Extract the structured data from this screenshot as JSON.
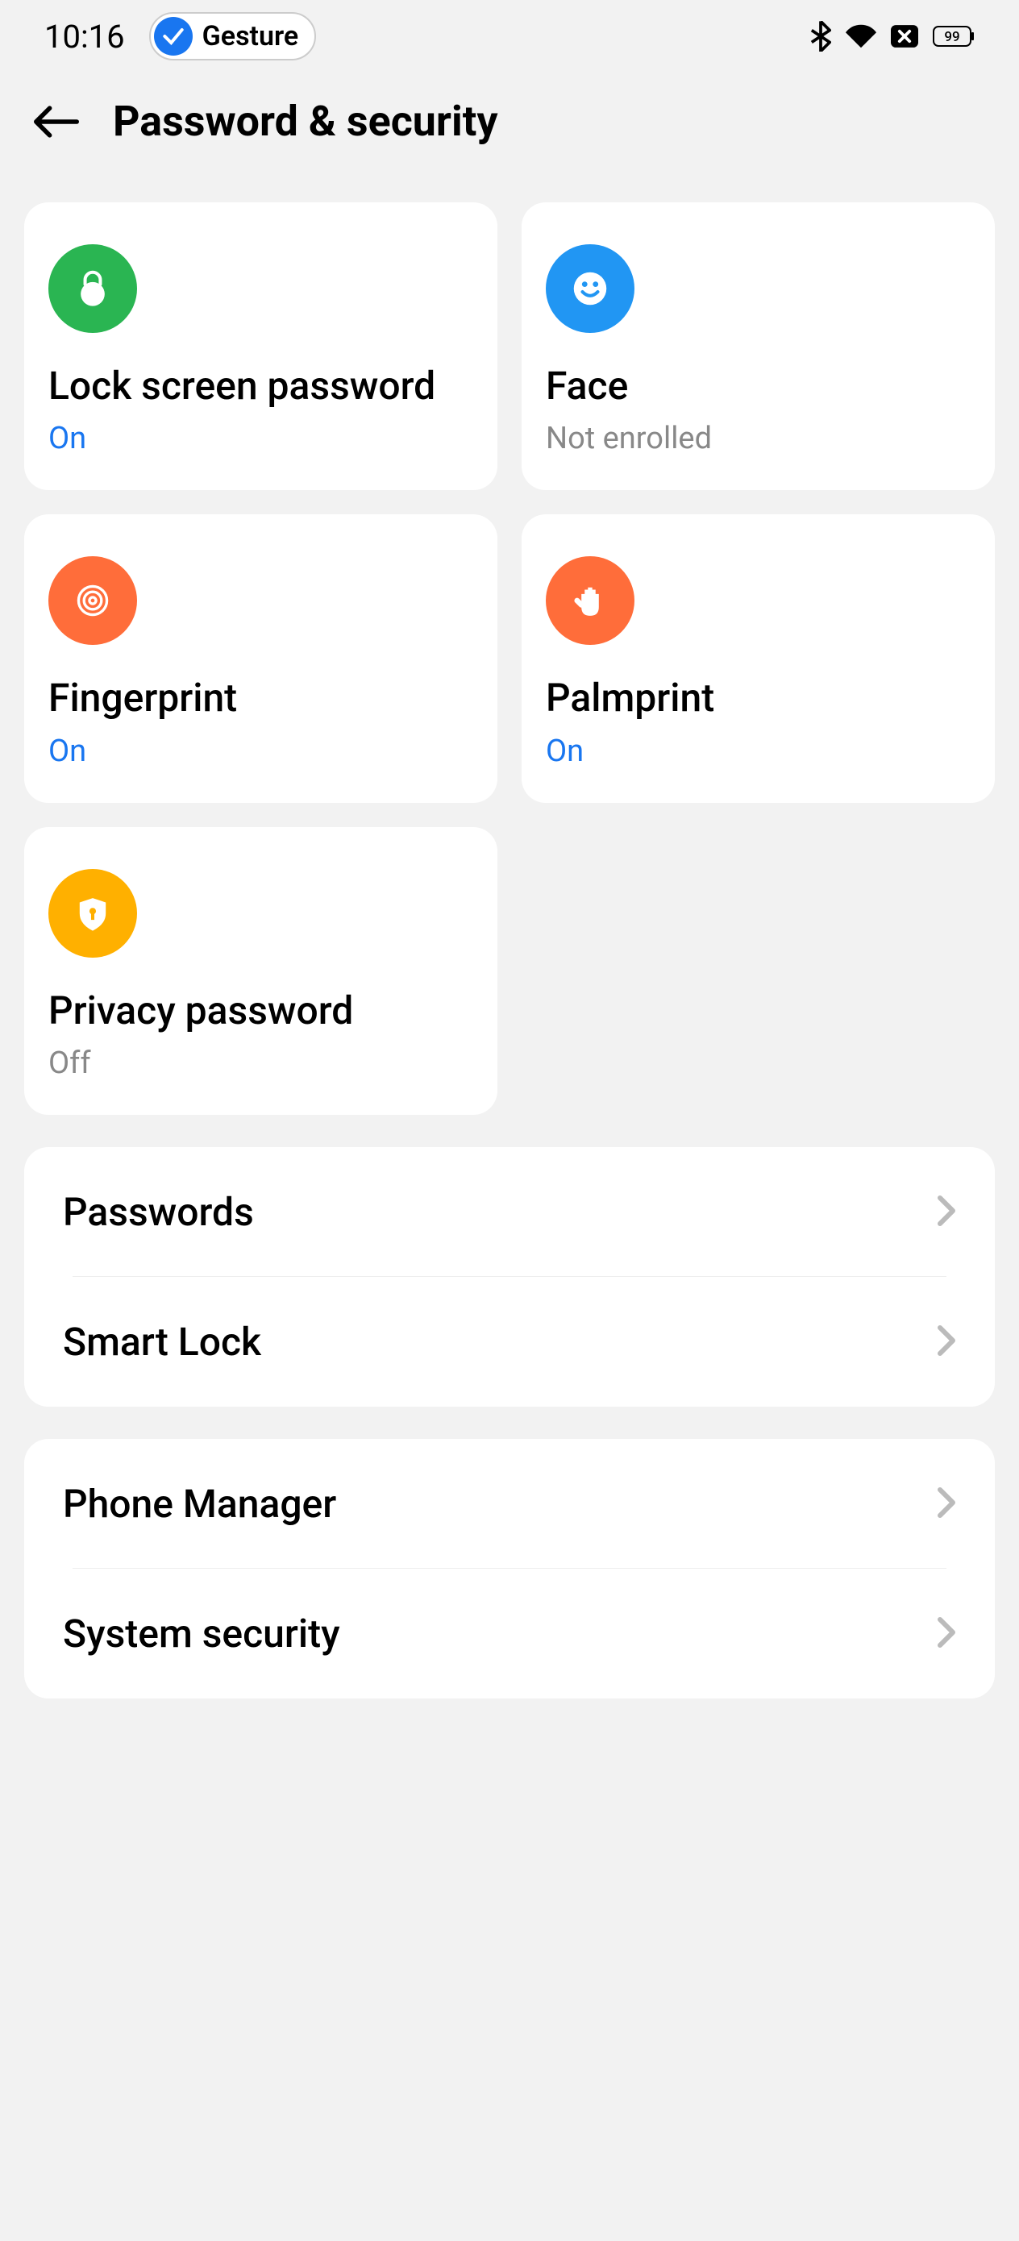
{
  "statusBar": {
    "time": "10:16",
    "gestureLabel": "Gesture",
    "battery": "99"
  },
  "header": {
    "title": "Password & security"
  },
  "cards": {
    "lockScreen": {
      "title": "Lock screen password",
      "status": "On"
    },
    "face": {
      "title": "Face",
      "status": "Not enrolled"
    },
    "fingerprint": {
      "title": "Fingerprint",
      "status": "On"
    },
    "palmprint": {
      "title": "Palmprint",
      "status": "On"
    },
    "privacy": {
      "title": "Privacy password",
      "status": "Off"
    }
  },
  "list1": {
    "passwords": "Passwords",
    "smartLock": "Smart Lock"
  },
  "list2": {
    "phoneManager": "Phone Manager",
    "systemSecurity": "System security"
  }
}
